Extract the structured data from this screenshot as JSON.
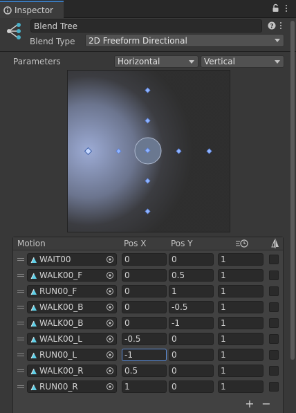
{
  "tab": {
    "title": "Inspector"
  },
  "blend_tree": {
    "name": "Blend Tree",
    "type_label": "Blend Type",
    "type_value": "2D Freeform Directional",
    "parameters_label": "Parameters",
    "param_x": "Horizontal",
    "param_y": "Vertical"
  },
  "table": {
    "headers": {
      "motion": "Motion",
      "pos_x": "Pos X",
      "pos_y": "Pos Y"
    },
    "rows": [
      {
        "motion": "WAIT00",
        "x": "0",
        "y": "0",
        "speed": "1",
        "mirror": false
      },
      {
        "motion": "WALK00_F",
        "x": "0",
        "y": "0.5",
        "speed": "1",
        "mirror": false
      },
      {
        "motion": "RUN00_F",
        "x": "0",
        "y": "1",
        "speed": "1",
        "mirror": false
      },
      {
        "motion": "WALK00_B",
        "x": "0",
        "y": "-0.5",
        "speed": "1",
        "mirror": false
      },
      {
        "motion": "WALK00_B",
        "x": "0",
        "y": "-1",
        "speed": "1",
        "mirror": false
      },
      {
        "motion": "WALK00_L",
        "x": "-0.5",
        "y": "0",
        "speed": "1",
        "mirror": false
      },
      {
        "motion": "RUN00_L",
        "x": "-1",
        "y": "0",
        "speed": "1",
        "mirror": false,
        "focused": true
      },
      {
        "motion": "WALK00_R",
        "x": "0.5",
        "y": "0",
        "speed": "1",
        "mirror": false
      },
      {
        "motion": "RUN00_R",
        "x": "1",
        "y": "0",
        "speed": "1",
        "mirror": false
      }
    ],
    "add_label": "+",
    "remove_label": "−"
  },
  "colors": {
    "accent": "#3a79bb",
    "point": "#8fb4ff",
    "panel": "#383838"
  },
  "icons": [
    "inspector-icon",
    "lock-icon",
    "menu-icon",
    "blend-tree-icon",
    "help-icon",
    "settings-icon",
    "animation-clip-icon",
    "object-picker-icon",
    "time-scale-icon",
    "mirror-icon"
  ]
}
